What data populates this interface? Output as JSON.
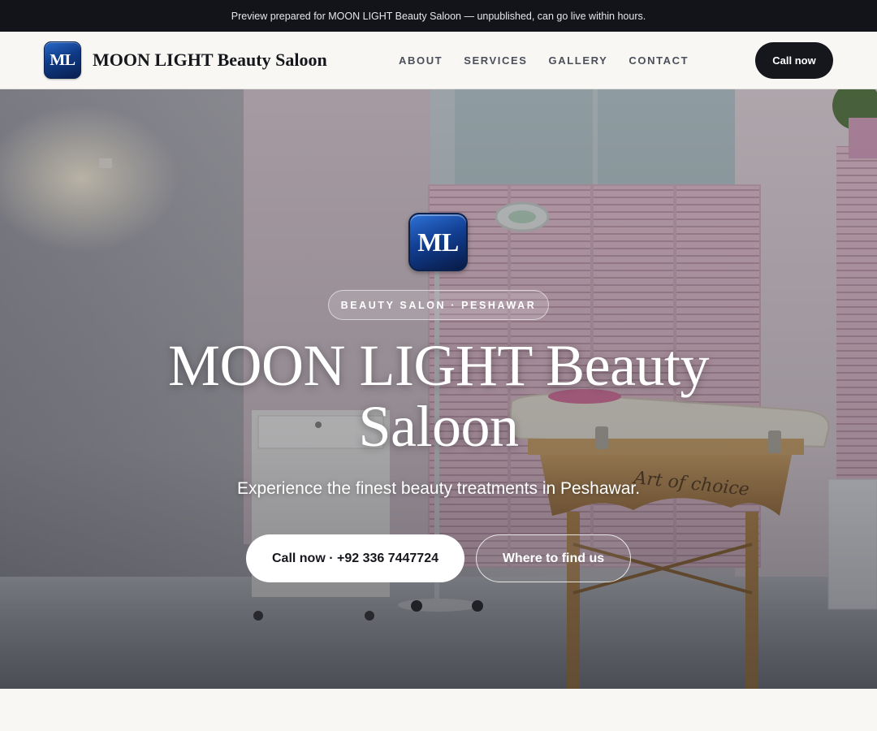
{
  "preview_banner": {
    "text": "Preview prepared for MOON LIGHT Beauty Saloon — unpublished, can go live within hours."
  },
  "header": {
    "logo_text": "ML",
    "brand_name": "MOON LIGHT Beauty Saloon",
    "nav": [
      {
        "label": "ABOUT"
      },
      {
        "label": "SERVICES"
      },
      {
        "label": "GALLERY"
      },
      {
        "label": "CONTACT"
      }
    ],
    "cta_label": "Call now"
  },
  "hero": {
    "logo_text": "ML",
    "tag": "BEAUTY SALON · PESHAWAR",
    "title": "MOON LIGHT Beauty Saloon",
    "subtitle": "Experience the finest beauty treatments in Peshawar.",
    "primary_button": "Call now · +92 336 7447724",
    "secondary_button": "Where to find us",
    "background_image": "salon-treatment-room-photo",
    "table_script_text": "Art of choice"
  },
  "colors": {
    "banner_bg": "#12141a",
    "header_bg": "#f8f7f4",
    "dark_button": "#15171c",
    "logo_blue": "#123f93",
    "wall_pink": "#e9c6d3"
  }
}
